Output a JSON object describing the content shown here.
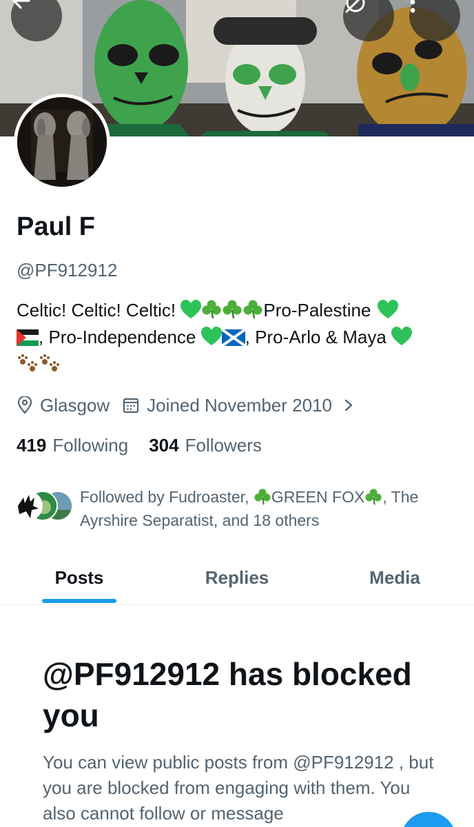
{
  "header": {
    "back_icon": "arrow-left-icon",
    "proxy_icon": "no-symbol-icon",
    "more_icon": "more-vertical-icon"
  },
  "profile": {
    "name": "Paul F",
    "handle": "@PF912912",
    "bio": {
      "line1_text": "Celtic! Celtic! Celtic! ",
      "line1_after": "Pro-Palestine ",
      "line2_a": ", Pro-Independence ",
      "line2_b": ", Pro-Arlo & Maya "
    },
    "location": "Glasgow",
    "joined": "Joined November 2010",
    "following_count": "419",
    "following_label": "Following",
    "followers_count": "304",
    "followers_label": "Followers",
    "followed_by": {
      "prefix": "Followed by Fudroaster, ",
      "green_fox": "GREEN FOX",
      "suffix": ", The Ayrshire Separatist, and 18 others"
    }
  },
  "tabs": [
    {
      "label": "Posts",
      "active": true
    },
    {
      "label": "Replies",
      "active": false
    },
    {
      "label": "Media",
      "active": false
    }
  ],
  "blocked": {
    "title": "@PF912912 has blocked you",
    "body": "You can view public posts from @PF912912 , but you are blocked from engaging with them. You also cannot follow or message"
  },
  "colors": {
    "accent": "#1d9bf0",
    "text_primary": "#0f1419",
    "text_secondary": "#536471",
    "green_heart": "#2ec25a"
  }
}
